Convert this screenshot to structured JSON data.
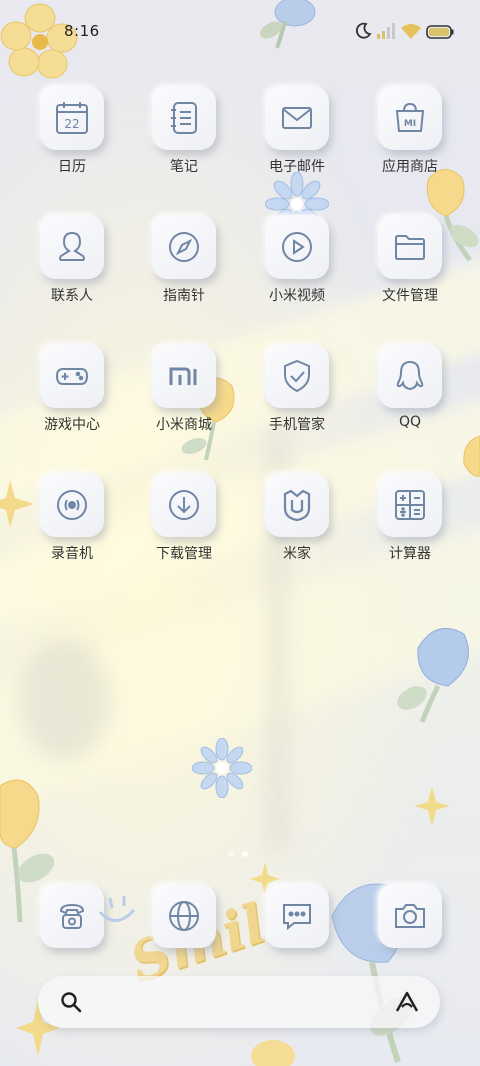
{
  "status_bar": {
    "time": "8:16",
    "icons": [
      "moon-icon",
      "signal-icon",
      "wifi-icon",
      "battery-icon"
    ]
  },
  "apps": [
    {
      "label": "日历",
      "icon": "calendar-icon",
      "icon_text": "22"
    },
    {
      "label": "笔记",
      "icon": "notes-icon"
    },
    {
      "label": "电子邮件",
      "icon": "mail-icon"
    },
    {
      "label": "应用商店",
      "icon": "app-store-icon",
      "icon_text": "MI"
    },
    {
      "label": "联系人",
      "icon": "contacts-icon"
    },
    {
      "label": "指南针",
      "icon": "compass-icon"
    },
    {
      "label": "小米视频",
      "icon": "video-icon"
    },
    {
      "label": "文件管理",
      "icon": "folder-icon"
    },
    {
      "label": "游戏中心",
      "icon": "gamepad-icon"
    },
    {
      "label": "小米商城",
      "icon": "mi-store-icon"
    },
    {
      "label": "手机管家",
      "icon": "security-shield-icon"
    },
    {
      "label": "QQ",
      "icon": "qq-icon"
    },
    {
      "label": "录音机",
      "icon": "recorder-icon"
    },
    {
      "label": "下载管理",
      "icon": "download-icon"
    },
    {
      "label": "米家",
      "icon": "mijia-icon"
    },
    {
      "label": "计算器",
      "icon": "calculator-icon"
    }
  ],
  "page_indicator": {
    "pages": 2,
    "current": 1
  },
  "dock": [
    {
      "icon": "phone-icon"
    },
    {
      "icon": "browser-icon"
    },
    {
      "icon": "messages-icon"
    },
    {
      "icon": "camera-icon"
    }
  ],
  "search_bar": {
    "left_icon": "search-icon",
    "right_icon": "assistant-icon"
  },
  "wallpaper": {
    "accent_text": "Smile",
    "colors": {
      "yellow": "#f3d98a",
      "blue": "#b9cdeb",
      "green": "#c8d6c0"
    }
  },
  "theme": {
    "icon_stroke": "#6f86a5",
    "label_color": "#333333"
  }
}
